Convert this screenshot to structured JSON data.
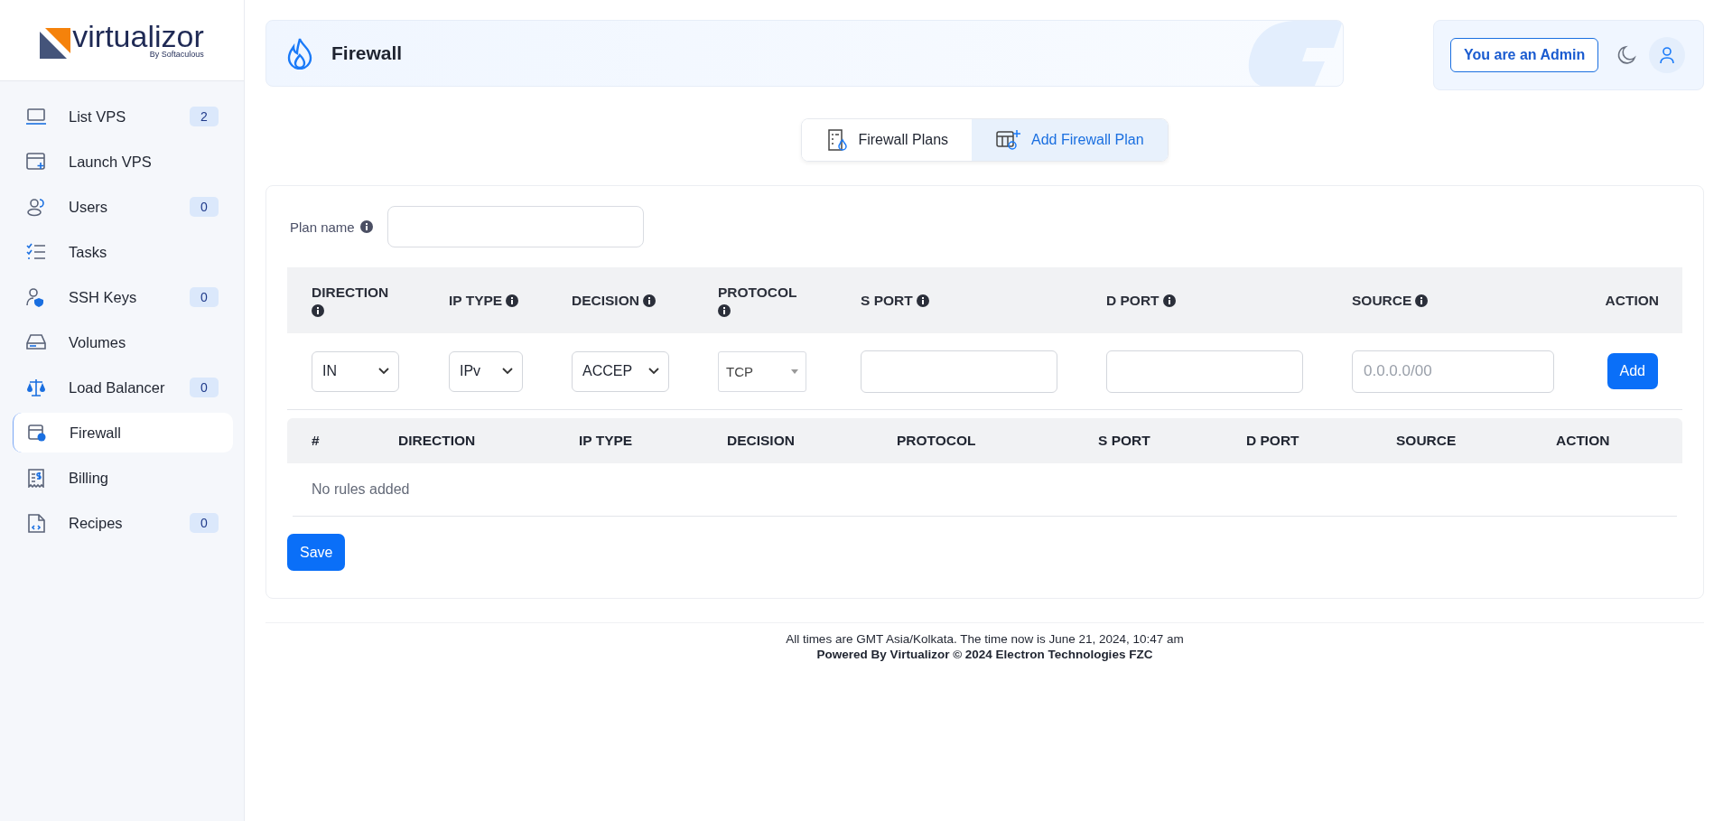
{
  "logo": {
    "name": "virtualizor",
    "tagline": "By Softaculous"
  },
  "sidebar": {
    "items": [
      {
        "label": "List VPS",
        "badge": "2",
        "selected": false
      },
      {
        "label": "Launch VPS",
        "selected": false
      },
      {
        "label": "Users",
        "badge": "0",
        "selected": false
      },
      {
        "label": "Tasks",
        "selected": false
      },
      {
        "label": "SSH Keys",
        "badge": "0",
        "selected": false
      },
      {
        "label": "Volumes",
        "selected": false
      },
      {
        "label": "Load Balancer",
        "badge": "0",
        "selected": false
      },
      {
        "label": "Firewall",
        "selected": true
      },
      {
        "label": "Billing",
        "selected": false
      },
      {
        "label": "Recipes",
        "badge": "0",
        "selected": false
      }
    ]
  },
  "header": {
    "title": "Firewall",
    "admin_button": "You are an Admin"
  },
  "tabs": [
    {
      "label": "Firewall Plans",
      "selected": false
    },
    {
      "label": "Add Firewall Plan",
      "selected": true
    }
  ],
  "form": {
    "plan_name_label": "Plan name",
    "rule_columns": [
      {
        "label": "DIRECTION",
        "info": true
      },
      {
        "label": "IP TYPE",
        "info": true
      },
      {
        "label": "DECISION",
        "info": true
      },
      {
        "label": "PROTOCOL",
        "info": true
      },
      {
        "label": "S PORT",
        "info": true
      },
      {
        "label": "D PORT",
        "info": true
      },
      {
        "label": "SOURCE",
        "info": true
      },
      {
        "label": "ACTION",
        "info": false
      }
    ],
    "rule_inputs": [
      {
        "kind": "select",
        "value": "IN"
      },
      {
        "kind": "select",
        "value": "IPv"
      },
      {
        "kind": "select",
        "value": "ACCEP"
      },
      {
        "kind": "dropdown",
        "value": "TCP"
      },
      {
        "kind": "input"
      },
      {
        "kind": "input"
      },
      {
        "kind": "input",
        "placeholder": "0.0.0.0/00"
      },
      {
        "kind": "button",
        "label": "Add"
      }
    ],
    "rules_table": {
      "columns": [
        "#",
        "DIRECTION",
        "IP TYPE",
        "DECISION",
        "PROTOCOL",
        "S PORT",
        "D PORT",
        "SOURCE",
        "ACTION"
      ],
      "empty_text": "No rules added"
    },
    "save_button": "Save"
  },
  "footer": {
    "time_note": "All times are GMT Asia/Kolkata. The time now is June 21, 2024, 10:47 am",
    "powered_by": "Powered By Virtualizor © 2024 Electron Technologies FZC"
  }
}
